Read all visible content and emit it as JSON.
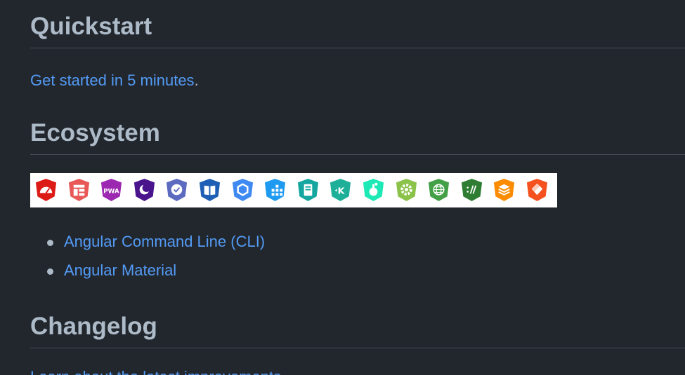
{
  "quickstart": {
    "heading": "Quickstart",
    "link_text": "Get started in 5 minutes",
    "trailing": "."
  },
  "ecosystem": {
    "heading": "Ecosystem",
    "badges": [
      {
        "icon": "angular-cli-icon",
        "color": "#dd1b16"
      },
      {
        "icon": "layout-icon",
        "color": "#e85856"
      },
      {
        "icon": "pwa-icon",
        "color": "#9c27b0"
      },
      {
        "icon": "moon-icon",
        "color": "#4a148c"
      },
      {
        "icon": "check-shield-icon",
        "color": "#5c6bc0"
      },
      {
        "icon": "book-icon",
        "color": "#1e5fb5"
      },
      {
        "icon": "hexagon-icon",
        "color": "#3f8af2"
      },
      {
        "icon": "grid-icon",
        "color": "#1e9af0"
      },
      {
        "icon": "server-icon",
        "color": "#16a6a0"
      },
      {
        "icon": "k-icon",
        "color": "#1eaf98"
      },
      {
        "icon": "flask-icon",
        "color": "#1de9b6"
      },
      {
        "icon": "gear-icon",
        "color": "#8bc34a"
      },
      {
        "icon": "globe-icon",
        "color": "#43a047"
      },
      {
        "icon": "slashes-icon",
        "color": "#2e7d32"
      },
      {
        "icon": "layers-icon",
        "color": "#fb8c00"
      },
      {
        "icon": "diamond-icon",
        "color": "#f4511e"
      }
    ],
    "links": [
      {
        "label": "Angular Command Line (CLI)"
      },
      {
        "label": "Angular Material"
      }
    ]
  },
  "changelog": {
    "heading": "Changelog",
    "link_text": "Learn about the latest improvements"
  },
  "colors": {
    "background": "#22272e",
    "text": "#adbac7",
    "link": "#539bf5",
    "divider": "#444c56"
  }
}
